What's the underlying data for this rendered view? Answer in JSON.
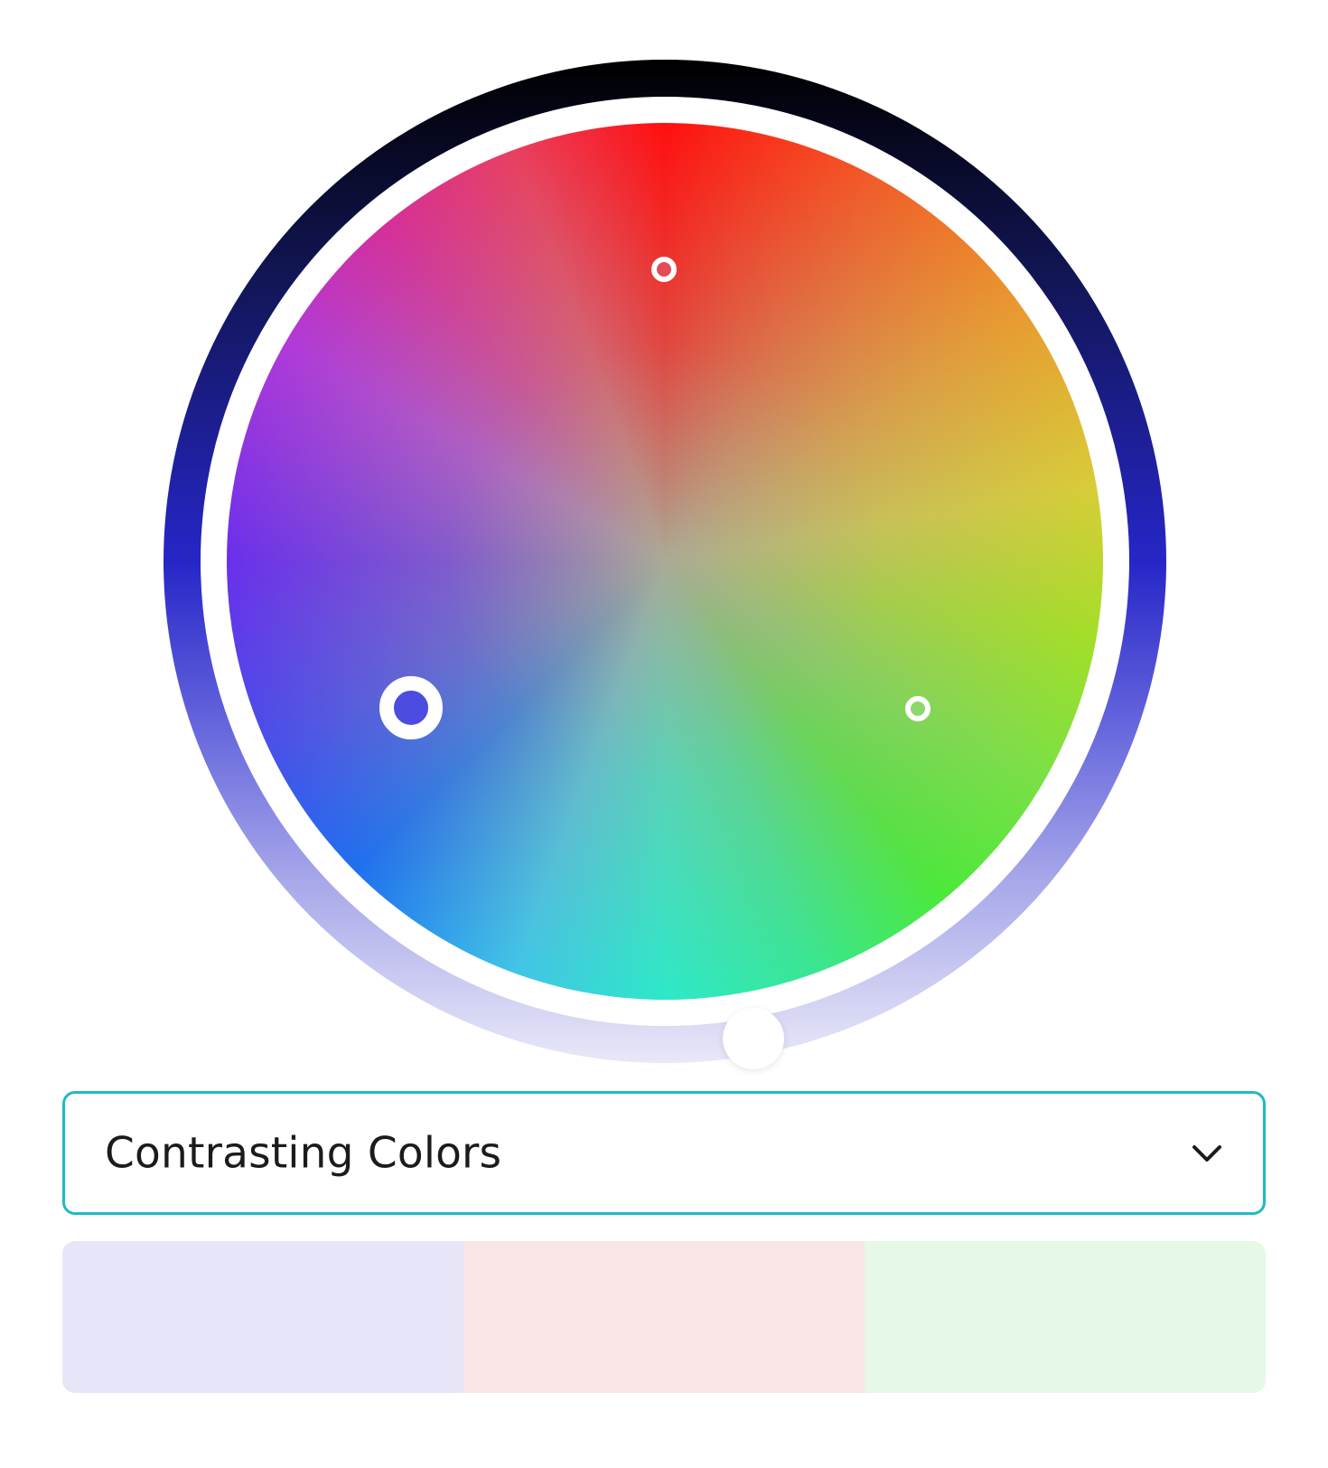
{
  "color_wheel": {
    "ring_colors": [
      "#000000",
      "#121656",
      "#2626c8",
      "#6060dc",
      "#a8a8ea",
      "#e8e8f8"
    ],
    "handles": [
      {
        "name": "base",
        "color": "#4b4ce0"
      },
      {
        "name": "top",
        "color": "#e44c58"
      },
      {
        "name": "right",
        "color": "#8cd86a"
      }
    ]
  },
  "harmony": {
    "selected": "Contrasting Colors",
    "icon": "chevron-down-icon"
  },
  "swatches": [
    {
      "color": "#e7e6f9"
    },
    {
      "color": "#f9e5e5"
    },
    {
      "color": "#e6f8e6"
    }
  ]
}
